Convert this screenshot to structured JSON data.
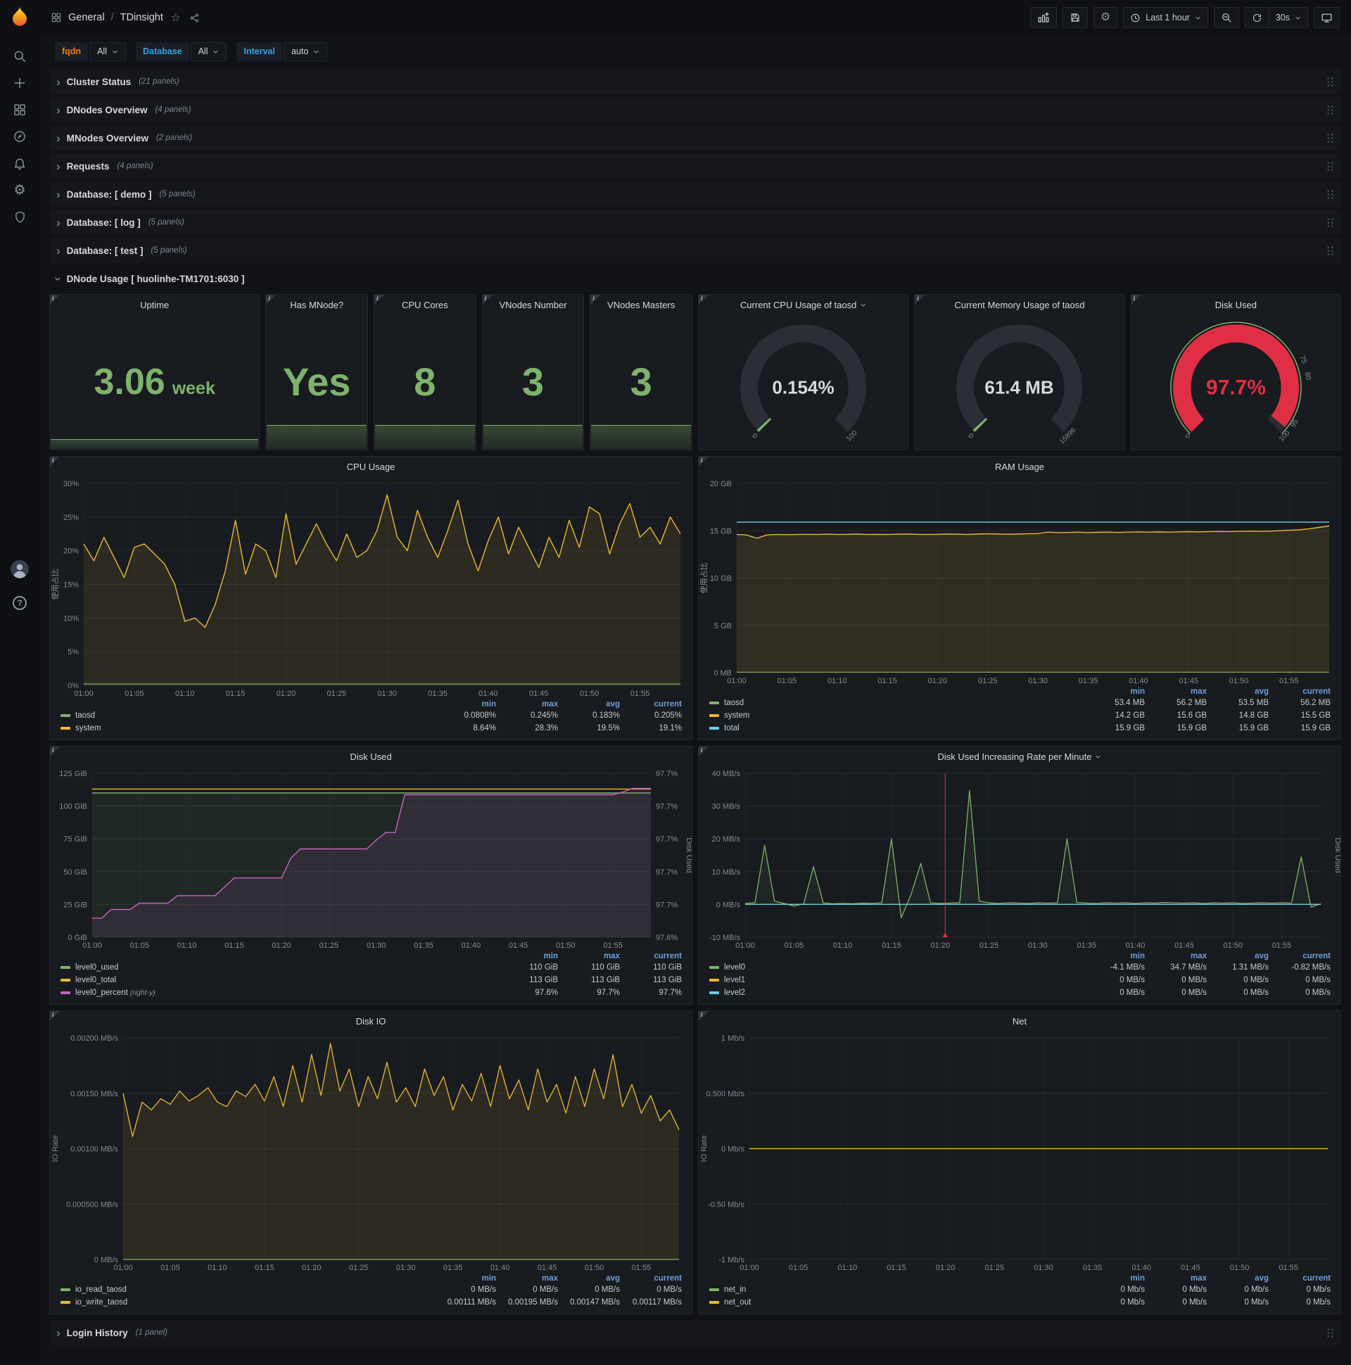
{
  "nav": {
    "breadcrumb": {
      "section": "General",
      "divider": "/",
      "title": "TDinsight"
    },
    "time_range": "Last 1 hour",
    "refresh_interval": "30s"
  },
  "variables": [
    {
      "label": "fqdn",
      "value": "All",
      "color": "#eb7b18"
    },
    {
      "label": "Database",
      "value": "All",
      "color": "#33a2e5"
    },
    {
      "label": "Interval",
      "value": "auto",
      "color": "#33a2e5"
    }
  ],
  "rows": {
    "collapsed_top": [
      {
        "title": "Cluster Status",
        "count": "(21 panels)"
      },
      {
        "title": "DNodes Overview",
        "count": "(4 panels)"
      },
      {
        "title": "MNodes Overview",
        "count": "(2 panels)"
      },
      {
        "title": "Requests",
        "count": "(4 panels)"
      },
      {
        "title": "Database: [ demo ]",
        "count": "(5 panels)"
      },
      {
        "title": "Database: [ log ]",
        "count": "(5 panels)"
      },
      {
        "title": "Database: [ test ]",
        "count": "(5 panels)"
      }
    ],
    "expanded": {
      "title": "DNode Usage [ huolinhe-TM1701:6030 ]"
    },
    "collapsed_bottom": [
      {
        "title": "Login History",
        "count": "(1 panel)"
      }
    ]
  },
  "stat_panels": [
    {
      "title": "Uptime",
      "value": "3.06",
      "unit": "week",
      "spark": 0.35
    },
    {
      "title": "Has MNode?",
      "value": "Yes",
      "spark": 0.85
    },
    {
      "title": "CPU Cores",
      "value": "8",
      "spark": 0.85
    },
    {
      "title": "VNodes Number",
      "value": "3",
      "spark": 0.85
    },
    {
      "title": "VNodes Masters",
      "value": "3",
      "spark": 0.85
    }
  ],
  "gauge_panels": [
    {
      "title": "Current CPU Usage of taosd",
      "title_caret": true,
      "value": "0.154%",
      "value_color": "#d8d9da",
      "fraction": 0.0015,
      "arc_color": "#7eb26d",
      "min_label": "0",
      "max_label": "100",
      "thresholds": [],
      "outline": false,
      "value_size": 26
    },
    {
      "title": "Current Memory Usage of taosd",
      "value": "61.4 MB",
      "value_color": "#d8d9da",
      "fraction": 0.0039,
      "arc_color": "#7eb26d",
      "min_label": "0",
      "max_label": "15896",
      "thresholds": [],
      "outline": false,
      "value_size": 26
    },
    {
      "title": "Disk Used",
      "value": "97.7%",
      "value_color": "#e02f44",
      "fraction": 0.977,
      "arc_color": "#e02f44",
      "min_label": "0",
      "max_label": "100",
      "thresholds": [
        {
          "f": 0.75,
          "label": "75"
        },
        {
          "f": 0.8,
          "label": "80"
        },
        {
          "f": 0.95,
          "label": "95"
        }
      ],
      "outline": true,
      "value_size": 30
    }
  ],
  "chart_data": [
    {
      "id": "cpu-usage",
      "type": "line",
      "title": "CPU Usage",
      "ylabel": "使用占比",
      "y_min": 0,
      "y_max": 30,
      "y_ticks": [
        "0%",
        "5%",
        "10%",
        "15%",
        "20%",
        "25%",
        "30%"
      ],
      "x_tick_labels": [
        "01:00",
        "01:05",
        "01:10",
        "01:15",
        "01:20",
        "01:25",
        "01:30",
        "01:35",
        "01:40",
        "01:45",
        "01:50",
        "01:55"
      ],
      "x_tick_step": 5,
      "x_max": 59,
      "margin_left": 48,
      "margin_right": 16,
      "legend_cols": [
        "min",
        "max",
        "avg",
        "current"
      ],
      "series": [
        {
          "name": "taosd",
          "color": "#7eb26d",
          "width": 1.2,
          "values": {
            "const": 0.2,
            "n": 60
          },
          "stats": [
            "0.0808%",
            "0.245%",
            "0.183%",
            "0.205%"
          ]
        },
        {
          "name": "system",
          "color": "#eab839",
          "width": 1.4,
          "fill": 0.1,
          "values": [
            21,
            18.5,
            22,
            19,
            16,
            20.5,
            21,
            19.5,
            18,
            15,
            9.5,
            10,
            8.6,
            12,
            17,
            24.5,
            16.5,
            21,
            20,
            16,
            25.5,
            18,
            21,
            24,
            21,
            18.5,
            22.5,
            19,
            20,
            23,
            28.3,
            22,
            20,
            26,
            22,
            19,
            23,
            27.5,
            21,
            17,
            21.5,
            25,
            19.5,
            23.5,
            20.5,
            17.5,
            22,
            19,
            24.5,
            20.5,
            26.5,
            25.5,
            19.5,
            24,
            27,
            22,
            23.5,
            21,
            25,
            22.5
          ],
          "stats": [
            "8.64%",
            "28.3%",
            "19.5%",
            "19.1%"
          ]
        }
      ]
    },
    {
      "id": "ram-usage",
      "type": "line",
      "title": "RAM Usage",
      "ylabel": "使用占比",
      "y_min": 0,
      "y_max": 20,
      "y_ticks": [
        "0 MB",
        "5 GB",
        "10 GB",
        "15 GB",
        "20 GB"
      ],
      "x_tick_labels": [
        "01:00",
        "01:05",
        "01:10",
        "01:15",
        "01:20",
        "01:25",
        "01:30",
        "01:35",
        "01:40",
        "01:45",
        "01:50",
        "01:55"
      ],
      "x_tick_step": 5,
      "x_max": 59,
      "margin_left": 54,
      "margin_right": 16,
      "legend_cols": [
        "min",
        "max",
        "avg",
        "current"
      ],
      "series": [
        {
          "name": "taosd",
          "color": "#7eb26d",
          "width": 1.2,
          "values": {
            "const": 0.055,
            "n": 60
          },
          "stats": [
            "53.4 MB",
            "56.2 MB",
            "53.5 MB",
            "56.2 MB"
          ]
        },
        {
          "name": "system",
          "color": "#eab839",
          "width": 1.4,
          "fill": 0.12,
          "values": [
            14.6,
            14.55,
            14.2,
            14.55,
            14.6,
            14.58,
            14.6,
            14.62,
            14.6,
            14.63,
            14.6,
            14.62,
            14.65,
            14.6,
            14.62,
            14.6,
            14.63,
            14.65,
            14.62,
            14.6,
            14.62,
            14.65,
            14.63,
            14.6,
            14.65,
            14.68,
            14.65,
            14.63,
            14.65,
            14.68,
            14.7,
            14.85,
            14.8,
            14.82,
            14.85,
            14.8,
            14.83,
            14.85,
            14.82,
            14.85,
            14.88,
            14.85,
            14.87,
            14.85,
            14.88,
            14.9,
            14.88,
            14.9,
            14.92,
            14.9,
            14.93,
            14.95,
            14.93,
            14.95,
            15.0,
            15.05,
            15.1,
            15.2,
            15.35,
            15.5
          ],
          "stats": [
            "14.2 GB",
            "15.6 GB",
            "14.8 GB",
            "15.5 GB"
          ]
        },
        {
          "name": "total",
          "color": "#6ed0e0",
          "width": 1.4,
          "values": {
            "const": 15.9,
            "n": 60
          },
          "stats": [
            "15.9 GB",
            "15.9 GB",
            "15.9 GB",
            "15.9 GB"
          ]
        }
      ]
    },
    {
      "id": "disk-used",
      "type": "line",
      "title": "Disk Used",
      "y_min": 0,
      "y_max": 125,
      "y_ticks": [
        "0 GiB",
        "25 GiB",
        "50 GiB",
        "75 GiB",
        "100 GiB",
        "125 GiB"
      ],
      "y2_ticks": [
        "97.6%",
        "97.7%",
        "97.7%",
        "97.7%",
        "97.7%",
        "97.7%"
      ],
      "y2label": "Disk Used",
      "x_tick_labels": [
        "01:00",
        "01:05",
        "01:10",
        "01:15",
        "01:20",
        "01:25",
        "01:30",
        "01:35",
        "01:40",
        "01:45",
        "01:50",
        "01:55"
      ],
      "x_tick_step": 5,
      "x_max": 59,
      "margin_left": 60,
      "margin_right": 58,
      "legend_cols": [
        "min",
        "max",
        "current"
      ],
      "series": [
        {
          "name": "level0_used",
          "color": "#7eb26d",
          "width": 1.4,
          "fill": 0.09,
          "values": {
            "const": 110,
            "n": 60
          },
          "stats": [
            "110 GiB",
            "110 GiB",
            "110 GiB"
          ]
        },
        {
          "name": "level0_total",
          "color": "#eab839",
          "width": 1.4,
          "values": {
            "const": 113,
            "n": 60
          },
          "stats": [
            "113 GiB",
            "113 GiB",
            "113 GiB"
          ]
        },
        {
          "name": "level0_percent",
          "note": "(right-y)",
          "color": "#c964c0",
          "width": 1.4,
          "fill": 0.1,
          "yrange": [
            97.585,
            97.715
          ],
          "values": [
            97.6,
            97.6,
            97.607,
            97.607,
            97.607,
            97.612,
            97.612,
            97.612,
            97.612,
            97.618,
            97.618,
            97.618,
            97.618,
            97.618,
            97.625,
            97.632,
            97.632,
            97.632,
            97.632,
            97.632,
            97.632,
            97.648,
            97.655,
            97.655,
            97.655,
            97.655,
            97.655,
            97.655,
            97.655,
            97.655,
            97.662,
            97.668,
            97.668,
            97.698,
            97.698,
            97.698,
            97.698,
            97.698,
            97.698,
            97.698,
            97.698,
            97.698,
            97.698,
            97.698,
            97.698,
            97.698,
            97.698,
            97.698,
            97.698,
            97.698,
            97.698,
            97.698,
            97.698,
            97.698,
            97.698,
            97.698,
            97.7,
            97.703,
            97.703,
            97.703
          ],
          "stats": [
            "97.6%",
            "97.7%",
            "97.7%"
          ]
        }
      ]
    },
    {
      "id": "disk-rate",
      "type": "line",
      "title": "Disk Used Increasing Rate per Minute",
      "title_caret": true,
      "y_min": -10,
      "y_max": 40,
      "y_ticks": [
        "-10 MB/s",
        "0 MB/s",
        "10 MB/s",
        "20 MB/s",
        "30 MB/s",
        "40 MB/s"
      ],
      "y2label": "Disk Used",
      "x_tick_labels": [
        "01:00",
        "01:05",
        "01:10",
        "01:15",
        "01:20",
        "01:25",
        "01:30",
        "01:35",
        "01:40",
        "01:45",
        "01:50",
        "01:55"
      ],
      "x_tick_step": 5,
      "x_max": 59,
      "margin_left": 66,
      "margin_right": 28,
      "legend_cols": [
        "min",
        "max",
        "avg",
        "current"
      ],
      "annotations": [
        {
          "x": 20.5,
          "color": "#e02f44"
        }
      ],
      "series": [
        {
          "name": "level0",
          "color": "#7eb26d",
          "width": 1.3,
          "fill": 0.08,
          "values": [
            0.3,
            0.5,
            18,
            1,
            0.3,
            -0.5,
            0.2,
            11.5,
            0.5,
            0.2,
            0.3,
            0.2,
            0.4,
            0.3,
            0.5,
            20,
            -4.1,
            3,
            12.5,
            0.5,
            0.3,
            0.4,
            0.5,
            34.7,
            1,
            0.5,
            0.3,
            0.5,
            0.4,
            0.3,
            0.5,
            0.4,
            0.5,
            20,
            0.6,
            0.4,
            0.3,
            0.5,
            0.4,
            0.5,
            0.3,
            0.5,
            0.4,
            0.6,
            0.5,
            0.4,
            0.5,
            0.3,
            0.5,
            0.4,
            0.5,
            0.3,
            0.4,
            0.5,
            0.4,
            0.5,
            0.4,
            14.5,
            -0.82,
            0.2
          ],
          "stats": [
            "-4.1 MB/s",
            "34.7 MB/s",
            "1.31 MB/s",
            "-0.82 MB/s"
          ]
        },
        {
          "name": "level1",
          "color": "#eab839",
          "width": 1.2,
          "values": {
            "const": 0,
            "n": 60
          },
          "stats": [
            "0 MB/s",
            "0 MB/s",
            "0 MB/s",
            "0 MB/s"
          ]
        },
        {
          "name": "level2",
          "color": "#6ed0e0",
          "width": 1.2,
          "values": {
            "const": 0,
            "n": 60
          },
          "stats": [
            "0 MB/s",
            "0 MB/s",
            "0 MB/s",
            "0 MB/s"
          ]
        }
      ]
    },
    {
      "id": "disk-io",
      "type": "line",
      "title": "Disk IO",
      "ylabel": "IO Rate",
      "y_min": 0,
      "y_max": 0.002,
      "y_ticks": [
        "0 MB/s",
        "0.000500 MB/s",
        "0.00100 MB/s",
        "0.00150 MB/s",
        "0.00200 MB/s"
      ],
      "x_tick_labels": [
        "01:00",
        "01:05",
        "01:10",
        "01:15",
        "01:20",
        "01:25",
        "01:30",
        "01:35",
        "01:40",
        "01:45",
        "01:50",
        "01:55"
      ],
      "x_tick_step": 5,
      "x_max": 59,
      "margin_left": 104,
      "margin_right": 18,
      "legend_cols": [
        "min",
        "max",
        "avg",
        "current"
      ],
      "series": [
        {
          "name": "io_read_taosd",
          "color": "#7eb26d",
          "width": 1.2,
          "values": {
            "const": 0,
            "n": 60
          },
          "stats": [
            "0 MB/s",
            "0 MB/s",
            "0 MB/s",
            "0 MB/s"
          ]
        },
        {
          "name": "io_write_taosd",
          "color": "#eab839",
          "width": 1.3,
          "fill": 0.1,
          "values": [
            0.0015,
            0.00111,
            0.00142,
            0.00135,
            0.00145,
            0.0014,
            0.00152,
            0.00143,
            0.00148,
            0.00155,
            0.00142,
            0.00138,
            0.00152,
            0.00147,
            0.00158,
            0.00143,
            0.00165,
            0.00138,
            0.00175,
            0.00142,
            0.00185,
            0.00148,
            0.00195,
            0.00152,
            0.00172,
            0.00138,
            0.00165,
            0.00145,
            0.00178,
            0.00142,
            0.00155,
            0.00138,
            0.00172,
            0.00148,
            0.00165,
            0.00135,
            0.00158,
            0.00143,
            0.00168,
            0.00138,
            0.00175,
            0.00145,
            0.00162,
            0.00135,
            0.00172,
            0.00142,
            0.00158,
            0.00132,
            0.00165,
            0.00138,
            0.00172,
            0.00145,
            0.00185,
            0.00138,
            0.00158,
            0.00132,
            0.00148,
            0.00125,
            0.00135,
            0.00117
          ],
          "stats": [
            "0.00111 MB/s",
            "0.00195 MB/s",
            "0.00147 MB/s",
            "0.00117 MB/s"
          ]
        }
      ]
    },
    {
      "id": "net",
      "type": "line",
      "title": "Net",
      "ylabel": "IO Rate",
      "y_min": -1,
      "y_max": 1,
      "y_ticks": [
        "-1 Mb/s",
        "-0.50 Mb/s",
        "0 Mb/s",
        "0.500 Mb/s",
        "1 Mb/s"
      ],
      "x_tick_labels": [
        "01:00",
        "01:05",
        "01:10",
        "01:15",
        "01:20",
        "01:25",
        "01:30",
        "01:35",
        "01:40",
        "01:45",
        "01:50",
        "01:55"
      ],
      "x_tick_step": 5,
      "x_max": 59,
      "margin_left": 72,
      "margin_right": 18,
      "legend_cols": [
        "min",
        "max",
        "avg",
        "current"
      ],
      "series": [
        {
          "name": "net_in",
          "color": "#7eb26d",
          "width": 1.2,
          "values": {
            "const": 0,
            "n": 60
          },
          "stats": [
            "0 Mb/s",
            "0 Mb/s",
            "0 Mb/s",
            "0 Mb/s"
          ]
        },
        {
          "name": "net_out",
          "color": "#eab839",
          "width": 1.2,
          "values": {
            "const": 0,
            "n": 60
          },
          "stats": [
            "0 Mb/s",
            "0 Mb/s",
            "0 Mb/s",
            "0 Mb/s"
          ]
        }
      ]
    }
  ]
}
